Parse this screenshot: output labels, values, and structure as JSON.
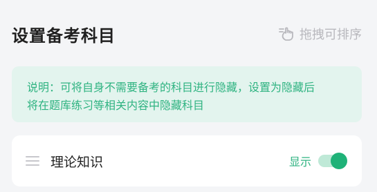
{
  "header": {
    "title": "设置备考科目",
    "drag_hint_label": "拖拽可排序",
    "drag_hint_icon": "hand-drag-icon"
  },
  "notice": {
    "text_line1": "说明：可将自身不需要备考的科目进行隐藏，设置为隐藏后",
    "text_line2": "将在题库练习等相关内容中隐藏科目"
  },
  "subjects": [
    {
      "name": "理论知识",
      "visibility_label": "显示",
      "visible": true
    }
  ],
  "colors": {
    "accent": "#1fb278",
    "notice_bg": "#e3f4ee",
    "hint_gray": "#b8b8bd"
  }
}
